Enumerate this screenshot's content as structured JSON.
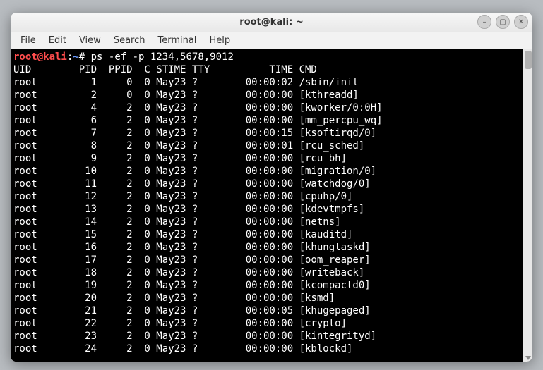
{
  "window": {
    "title": "root@kali: ~"
  },
  "menubar": {
    "items": [
      "File",
      "Edit",
      "View",
      "Search",
      "Terminal",
      "Help"
    ]
  },
  "prompt": {
    "user_host": "root@kali",
    "sep1": ":",
    "path": "~",
    "hash": "#",
    "command": "ps -ef -p 1234,5678,9012"
  },
  "header": "UID        PID  PPID  C STIME TTY          TIME CMD",
  "rows": [
    "root         1     0  0 May23 ?        00:00:02 /sbin/init",
    "root         2     0  0 May23 ?        00:00:00 [kthreadd]",
    "root         4     2  0 May23 ?        00:00:00 [kworker/0:0H]",
    "root         6     2  0 May23 ?        00:00:00 [mm_percpu_wq]",
    "root         7     2  0 May23 ?        00:00:15 [ksoftirqd/0]",
    "root         8     2  0 May23 ?        00:00:01 [rcu_sched]",
    "root         9     2  0 May23 ?        00:00:00 [rcu_bh]",
    "root        10     2  0 May23 ?        00:00:00 [migration/0]",
    "root        11     2  0 May23 ?        00:00:00 [watchdog/0]",
    "root        12     2  0 May23 ?        00:00:00 [cpuhp/0]",
    "root        13     2  0 May23 ?        00:00:00 [kdevtmpfs]",
    "root        14     2  0 May23 ?        00:00:00 [netns]",
    "root        15     2  0 May23 ?        00:00:00 [kauditd]",
    "root        16     2  0 May23 ?        00:00:00 [khungtaskd]",
    "root        17     2  0 May23 ?        00:00:00 [oom_reaper]",
    "root        18     2  0 May23 ?        00:00:00 [writeback]",
    "root        19     2  0 May23 ?        00:00:00 [kcompactd0]",
    "root        20     2  0 May23 ?        00:00:00 [ksmd]",
    "root        21     2  0 May23 ?        00:00:05 [khugepaged]",
    "root        22     2  0 May23 ?        00:00:00 [crypto]",
    "root        23     2  0 May23 ?        00:00:00 [kintegrityd]",
    "root        24     2  0 May23 ?        00:00:00 [kblockd]"
  ],
  "controls": {
    "minimize": "–",
    "maximize": "▢",
    "close": "✕"
  }
}
